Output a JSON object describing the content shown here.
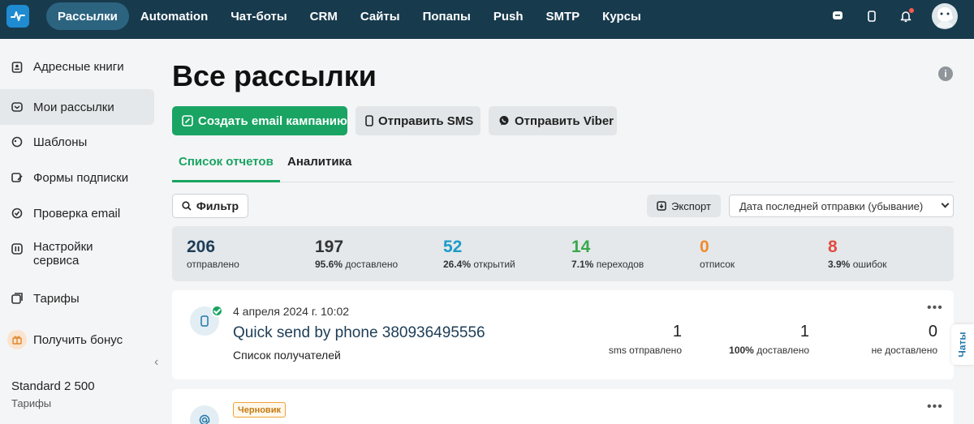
{
  "colors": {
    "topbar": "#173a4d",
    "accent_green": "#19a463",
    "sent": "#1d3d56",
    "opened": "#1d9bc9",
    "clicks": "#3aa84c",
    "unsub": "#f28b2c",
    "errors": "#e24b43"
  },
  "nav": {
    "items": [
      "Рассылки",
      "Automation",
      "Чат-боты",
      "CRM",
      "Сайты",
      "Попапы",
      "Push",
      "SMTP",
      "Курсы"
    ],
    "active_index": 0
  },
  "top_icons": [
    "chat-icon",
    "phone-icon",
    "bell-icon",
    "avatar"
  ],
  "sidebar": {
    "items": [
      {
        "label": "Адресные книги",
        "icon": "address-book-icon"
      },
      {
        "label": "Мои рассылки",
        "icon": "mailing-icon",
        "active": true
      },
      {
        "label": "Шаблоны",
        "icon": "templates-icon"
      },
      {
        "label": "Формы подписки",
        "icon": "forms-icon"
      },
      {
        "label": "Проверка email",
        "icon": "check-icon"
      },
      {
        "label": "Настройки сервиса",
        "icon": "settings-icon"
      },
      {
        "label": "Тарифы",
        "icon": "tariffs-icon"
      }
    ],
    "bonus": "Получить бонус",
    "plan_name": "Standard 2 500",
    "plan_link": "Тарифы"
  },
  "page": {
    "title": "Все рассылки",
    "buttons": {
      "create_email": "Создать email кампанию",
      "send_sms": "Отправить SMS",
      "send_viber": "Отправить Viber"
    },
    "tabs": [
      "Список отчетов",
      "Аналитика"
    ],
    "filter_label": "Фильтр",
    "export_label": "Экспорт",
    "sort_value": "Дата последней отправки (убывание)"
  },
  "stats": [
    {
      "value": "206",
      "pct": "",
      "label": "отправлено"
    },
    {
      "value": "197",
      "pct": "95.6%",
      "label": "доставлено"
    },
    {
      "value": "52",
      "pct": "26.4%",
      "label": "открытий"
    },
    {
      "value": "14",
      "pct": "7.1%",
      "label": "переходов"
    },
    {
      "value": "0",
      "pct": "",
      "label": "отписок"
    },
    {
      "value": "8",
      "pct": "3.9%",
      "label": "ошибок"
    }
  ],
  "campaigns": [
    {
      "date": "4 апреля 2024 г. 10:02",
      "title": "Quick send by phone 380936495556",
      "subtitle": "Список получателей",
      "metrics": [
        {
          "value": "1",
          "pct": "",
          "label": "sms отправлено"
        },
        {
          "value": "1",
          "pct": "100%",
          "label": "доставлено"
        },
        {
          "value": "0",
          "pct": "",
          "label": "не доставлено"
        }
      ]
    },
    {
      "badge": "Черновик"
    }
  ],
  "chat_tab": "Чаты"
}
